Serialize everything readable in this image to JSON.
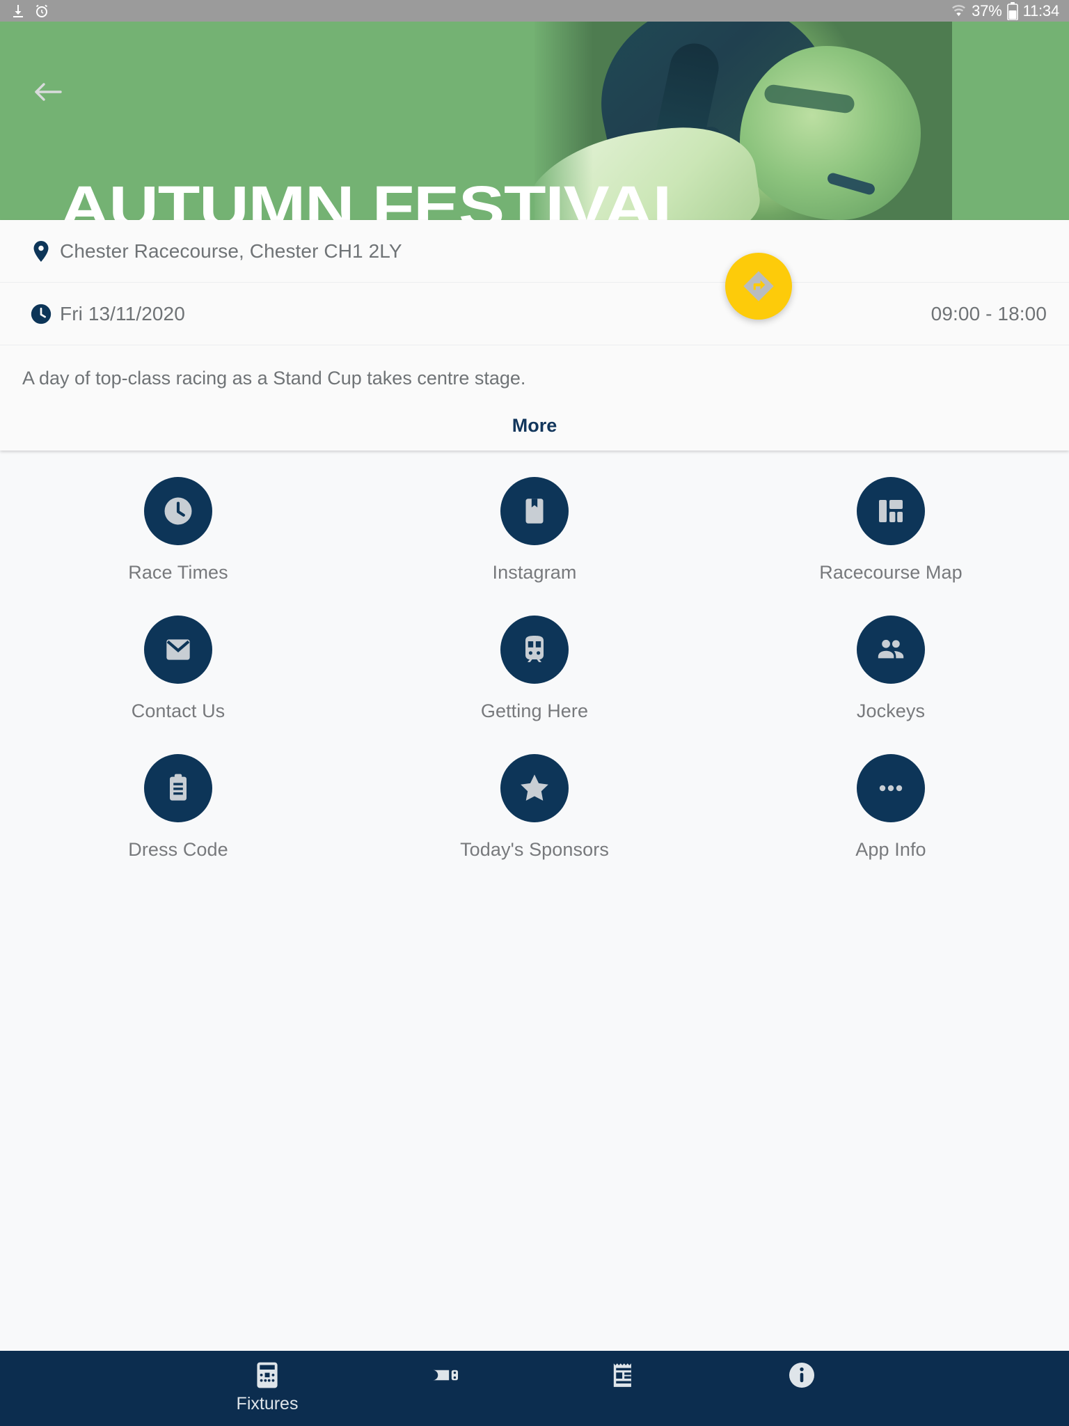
{
  "status_bar": {
    "icons_left": [
      "download-icon",
      "alarm-icon"
    ],
    "wifi_icon": "wifi-icon",
    "battery_percent": "37%",
    "battery_icon": "battery-icon",
    "time": "11:34"
  },
  "hero": {
    "title": "AUTUMN FESTIVAL",
    "back_icon": "back-arrow-icon",
    "tint_color": "#74b273",
    "photo_alt": "jockey-photo"
  },
  "fab": {
    "icon": "directions-diamond-icon",
    "color": "#fdcb0a",
    "icon_color": "#b9bcc0"
  },
  "card": {
    "location_icon": "location-pin-icon",
    "location": "Chester Racecourse, Chester CH1 2LY",
    "clock_icon": "clock-icon",
    "date": "Fri 13/11/2020",
    "time_range": "09:00 - 18:00",
    "description": "A day of top-class racing as a Stand Cup takes centre stage.",
    "more_label": "More",
    "accent_color": "#12365c"
  },
  "grid": {
    "circle_color": "#0d3558",
    "icon_color": "#c8ced4",
    "tiles": [
      {
        "label": "Race Times",
        "icon": "clock-icon"
      },
      {
        "label": "Instagram",
        "icon": "book-bookmark-icon"
      },
      {
        "label": "Racecourse Map",
        "icon": "dashboard-grid-icon"
      },
      {
        "label": "Contact Us",
        "icon": "mail-envelope-icon"
      },
      {
        "label": "Getting Here",
        "icon": "train-icon"
      },
      {
        "label": "Jockeys",
        "icon": "people-group-icon"
      },
      {
        "label": "Dress Code",
        "icon": "clipboard-icon"
      },
      {
        "label": "Today's Sponsors",
        "icon": "star-icon"
      },
      {
        "label": "App Info",
        "icon": "more-dots-icon"
      }
    ]
  },
  "bottom_nav": {
    "background_color": "#0c2d4f",
    "items": [
      {
        "label": "Fixtures",
        "icon": "fixtures-calendar-icon",
        "active": true
      },
      {
        "label": "",
        "icon": "ticket-icon",
        "active": false
      },
      {
        "label": "",
        "icon": "notes-calendar-icon",
        "active": false
      },
      {
        "label": "",
        "icon": "info-icon",
        "active": false
      }
    ]
  }
}
